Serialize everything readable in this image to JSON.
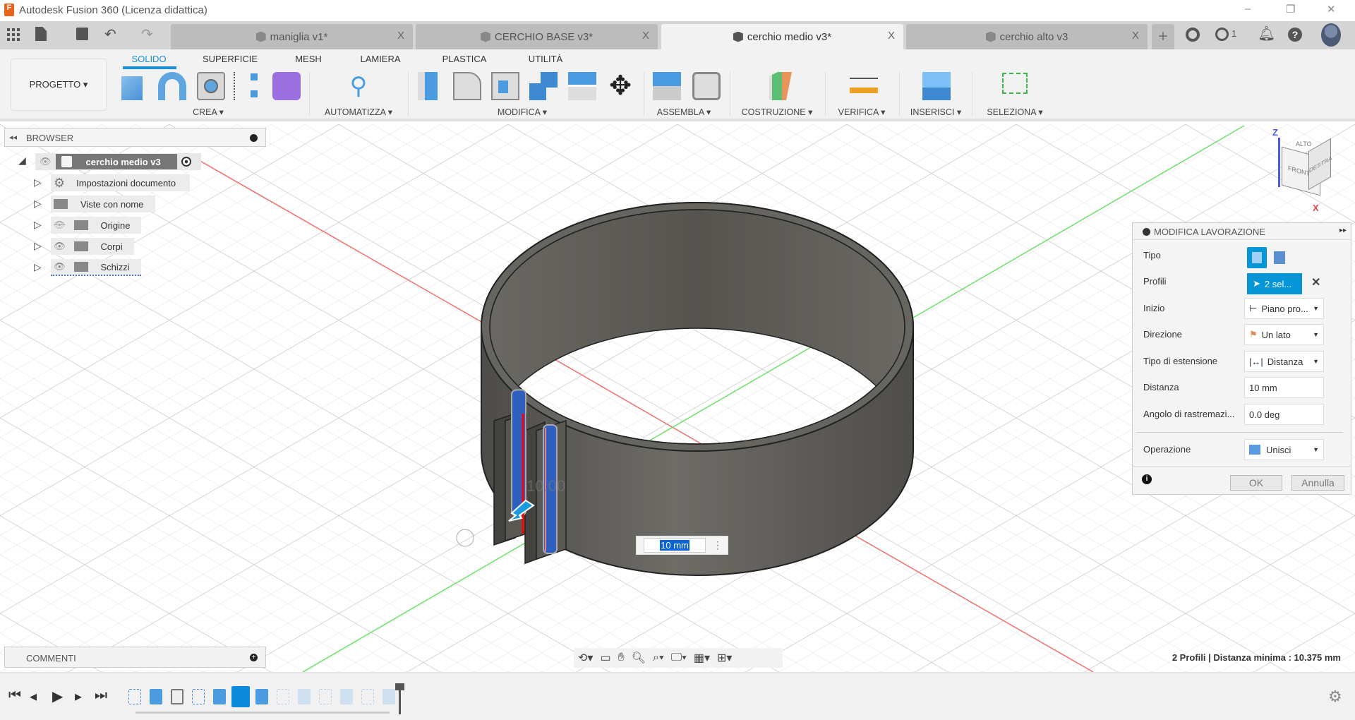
{
  "app": {
    "title": "Autodesk Fusion 360 (Licenza didattica)",
    "logo_letter": "F"
  },
  "window": {
    "minimize": "–",
    "restore": "❐",
    "close": "✕"
  },
  "tabs": [
    {
      "label": "maniglia v1*",
      "active": false
    },
    {
      "label": "CERCHIO BASE v3*",
      "active": false
    },
    {
      "label": "cerchio medio v3*",
      "active": true
    },
    {
      "label": "cerchio alto v3",
      "active": false
    }
  ],
  "tabbar": {
    "close": "X",
    "add": "+",
    "jobs_count": "1"
  },
  "ribbon": {
    "project_button": "PROGETTO ▾",
    "tabs": [
      "SOLIDO",
      "SUPERFICIE",
      "MESH",
      "LAMIERA",
      "PLASTICA",
      "UTILITÀ"
    ],
    "groups": [
      "CREA ▾",
      "AUTOMATIZZA ▾",
      "MODIFICA ▾",
      "ASSEMBLA ▾",
      "COSTRUZIONE ▾",
      "VERIFICA ▾",
      "INSERISCI ▾",
      "SELEZIONA ▾"
    ]
  },
  "browser": {
    "title": "BROWSER",
    "root": "cerchio medio v3",
    "items": [
      "Impostazioni documento",
      "Viste con nome",
      "Origine",
      "Corpi",
      "Schizzi"
    ]
  },
  "comments": {
    "title": "COMMENTI"
  },
  "viewcube": {
    "top": "ALTO",
    "front": "FRONTE",
    "right": "DESTRA",
    "z": "Z",
    "x": "X"
  },
  "dimension_input": {
    "value": "10 mm",
    "ghost": "10.00"
  },
  "dialog": {
    "title": "MODIFICA LAVORAZIONE",
    "rows": {
      "tipo": "Tipo",
      "profili": "Profili",
      "profili_value": "2 sel...",
      "inizio": "Inizio",
      "inizio_value": "Piano pro...",
      "direzione": "Direzione",
      "direzione_value": "Un lato",
      "estensione": "Tipo di estensione",
      "estensione_value": "Distanza",
      "distanza": "Distanza",
      "distanza_value": "10 mm",
      "angolo": "Angolo di rastremazi...",
      "angolo_value": "0.0 deg",
      "operazione": "Operazione",
      "operazione_value": "Unisci"
    },
    "ok": "OK",
    "cancel": "Annulla"
  },
  "status": "2 Profili | Distanza minima : 10.375 mm",
  "colors": {
    "accent": "#0696d7",
    "body": "#5f5d58",
    "profile": "#2f5fbf"
  }
}
